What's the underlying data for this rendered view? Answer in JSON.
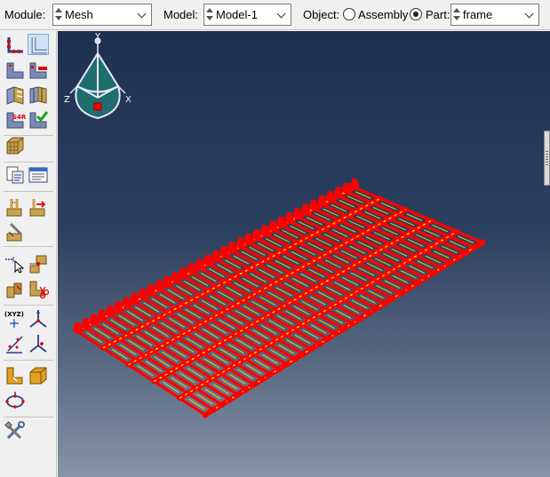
{
  "context_bar": {
    "module_label": "Module:",
    "module_value": "Mesh",
    "model_label": "Model:",
    "model_value": "Model-1",
    "object_label": "Object:",
    "assembly_label": "Assembly",
    "part_label": "Part:",
    "part_value": "frame",
    "object_selected": "Part"
  },
  "toolbox": {
    "groups": [
      [
        "seed-part-edge-tool",
        "seed-edge-tool"
      ],
      [
        "delete-seed-tool",
        "seed-edge-bias-tool"
      ],
      [
        "mesh-controls-tool",
        "partition-face-tool"
      ],
      [
        "element-type-s4r-tool",
        "verify-mesh-tool"
      ],
      [
        "mesh-part-tool"
      ],
      [
        "query-tool",
        "mesh-stats-tool"
      ],
      [
        "create-datum-point-tool",
        "edit-mesh-tool"
      ],
      [
        "partition-cell-tool"
      ],
      [
        "datum-axis-tool",
        "virtual-topology-tool"
      ],
      [
        "assign-orphan-mesh-tool",
        "delete-instance-tool"
      ],
      [
        "datum-point-xyz-tool",
        "datum-csys-tool"
      ],
      [
        "datum-plane-tool",
        "move-point-tool"
      ],
      [
        "partition-edge-tool",
        "create-shell-tool"
      ],
      [
        "sketch-loop-tool"
      ],
      [
        "tools-wrench-tool"
      ]
    ],
    "selected": "seed-edge-tool"
  },
  "viewport": {
    "colors": {
      "mesh_beams": "#ff0000",
      "mesh_elements": "#f5e800",
      "background_top": "#1e3050",
      "background_bottom": "#8594a8"
    },
    "triad": {
      "y_label": "Y",
      "z_label": "Z",
      "x_label": "X"
    }
  }
}
